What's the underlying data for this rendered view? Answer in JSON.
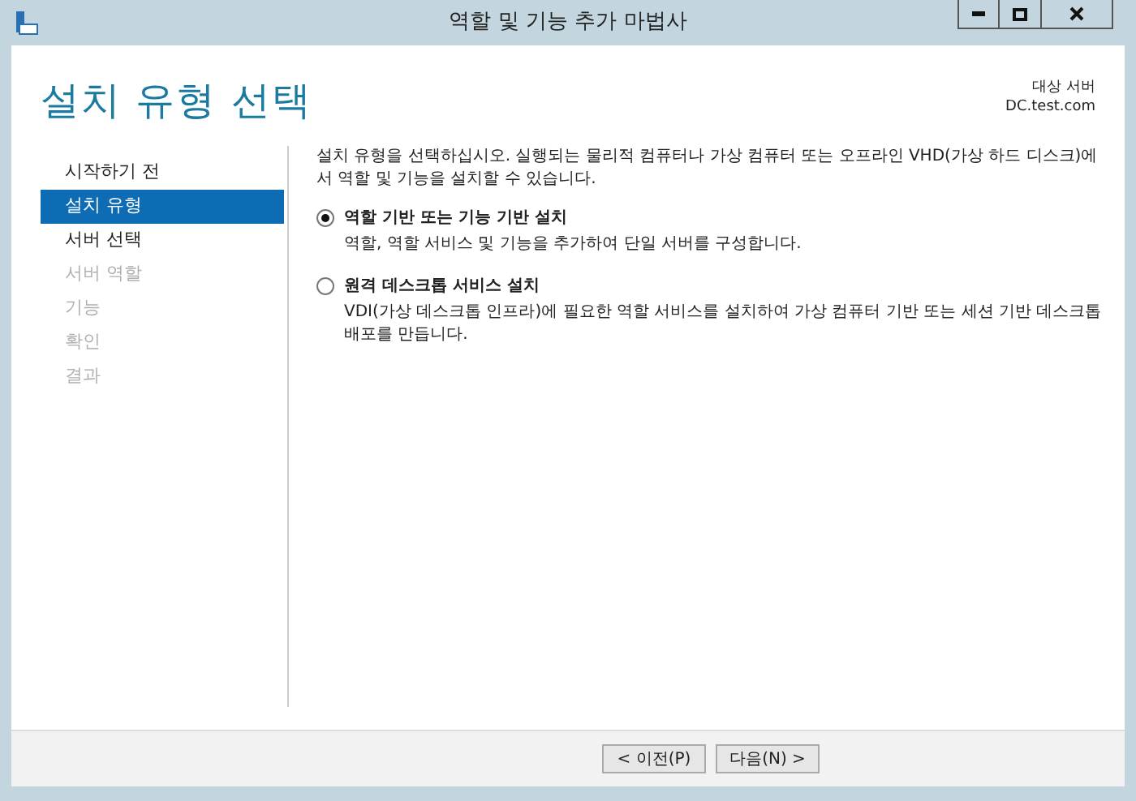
{
  "window": {
    "title": "역할 및 기능 추가 마법사"
  },
  "header": {
    "title": "설치 유형 선택",
    "target_label": "대상 서버",
    "target_server": "DC.test.com"
  },
  "steps": [
    {
      "label": "시작하기 전",
      "selected": false,
      "disabled": false
    },
    {
      "label": "설치 유형",
      "selected": true,
      "disabled": false
    },
    {
      "label": "서버 선택",
      "selected": false,
      "disabled": false
    },
    {
      "label": "서버 역할",
      "selected": false,
      "disabled": true
    },
    {
      "label": "기능",
      "selected": false,
      "disabled": true
    },
    {
      "label": "확인",
      "selected": false,
      "disabled": true
    },
    {
      "label": "결과",
      "selected": false,
      "disabled": true
    }
  ],
  "intro": "설치 유형을 선택하십시오. 실행되는 물리적 컴퓨터나 가상 컴퓨터 또는 오프라인 VHD(가상 하드 디스크)에서 역할 및 기능을 설치할 수 있습니다.",
  "options": [
    {
      "label": "역할 기반 또는 기능 기반 설치",
      "description": "역할, 역할 서비스 및 기능을 추가하여 단일 서버를 구성합니다.",
      "selected": true
    },
    {
      "label": "원격 데스크톱 서비스 설치",
      "description": "VDI(가상 데스크톱 인프라)에 필요한 역할 서비스를 설치하여 가상 컴퓨터 기반 또는 세션 기반 데스크톱 배포를 만듭니다.",
      "selected": false
    }
  ],
  "buttons": [
    "< 이전(P)",
    "다음(N) >"
  ]
}
